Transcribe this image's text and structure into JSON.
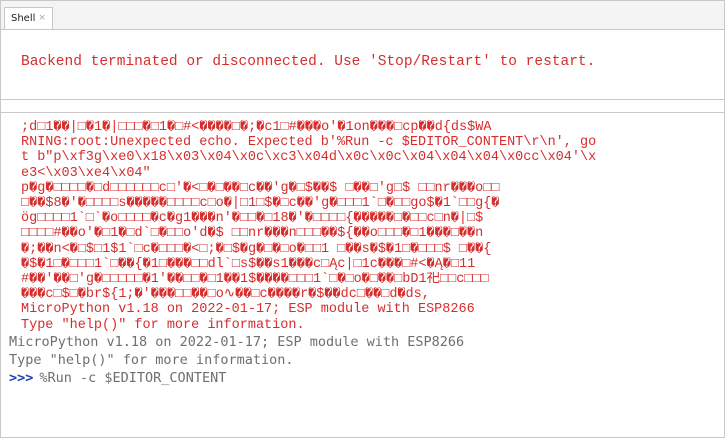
{
  "tab": {
    "label": "Shell",
    "close_glyph": "×"
  },
  "error_message": "Backend terminated or disconnected. Use 'Stop/Restart' to restart.",
  "output_lines": [
    ";d□1��|□�1�|□□□�□1�□#<����□�;�c1□#���o'�1on���□cp��d{ds$WA",
    "RNING:root:Unexpected echo. Expected b'%Run -c $EDITOR_CONTENT\\r\\n', go",
    "t b\"p\\xf3g\\xe0\\x18\\x03\\x04\\x0c\\xc3\\x04d\\x0c\\x0c\\x04\\x04\\x04\\x0cc\\x04'\\x",
    "e3<\\x03\\xe4\\x04\"",
    "p�g�□□□□�□d□□□□□□c□'�<□�□��□c��'g�□$��$ □��□'g□$ □□nr���o□□",
    "□��$8�'�□□□□s�����□□□□c□o�|□1□$�□c��'g�□□□1`□�□□go$�1`□□g{�",
    "ög□□□□1`□`�o□□□□�c�g1���n'�□□�□18�'�□□□□{�����□�□□c□n�|□$",
    "□□□□#��o'�□1�□d`□�□□o'd�$ □□nr���n□□□��${��o□□□�□1���□��n",
    "�;��n<�□$□1$1`□c�□□□�<□;�□$�g�□�□o�□□1 □��s�$�1□�□□□$ □��{",
    "�$�1□�□□□1`□��{�1□���□□dl`□s$��s1���c□Ąc|□1c���□#<�Ą�□11",
    "#��'��□'g�□□□□□�1'��□□�□1��1$����□□□1`□�□o�□��□bD1祀□□c□□□",
    "���c□$□�br${1;�'���□□��□o∿��□c����r�$��dc□��□d�ds,",
    "MicroPython v1.18 on 2022-01-17; ESP module with ESP8266",
    "Type \"help()\" for more information."
  ],
  "tail_lines": [
    "MicroPython v1.18 on 2022-01-17; ESP module with ESP8266",
    "Type \"help()\" for more information."
  ],
  "prompt": {
    "marker": ">>>",
    "command": "%Run -c $EDITOR_CONTENT"
  }
}
